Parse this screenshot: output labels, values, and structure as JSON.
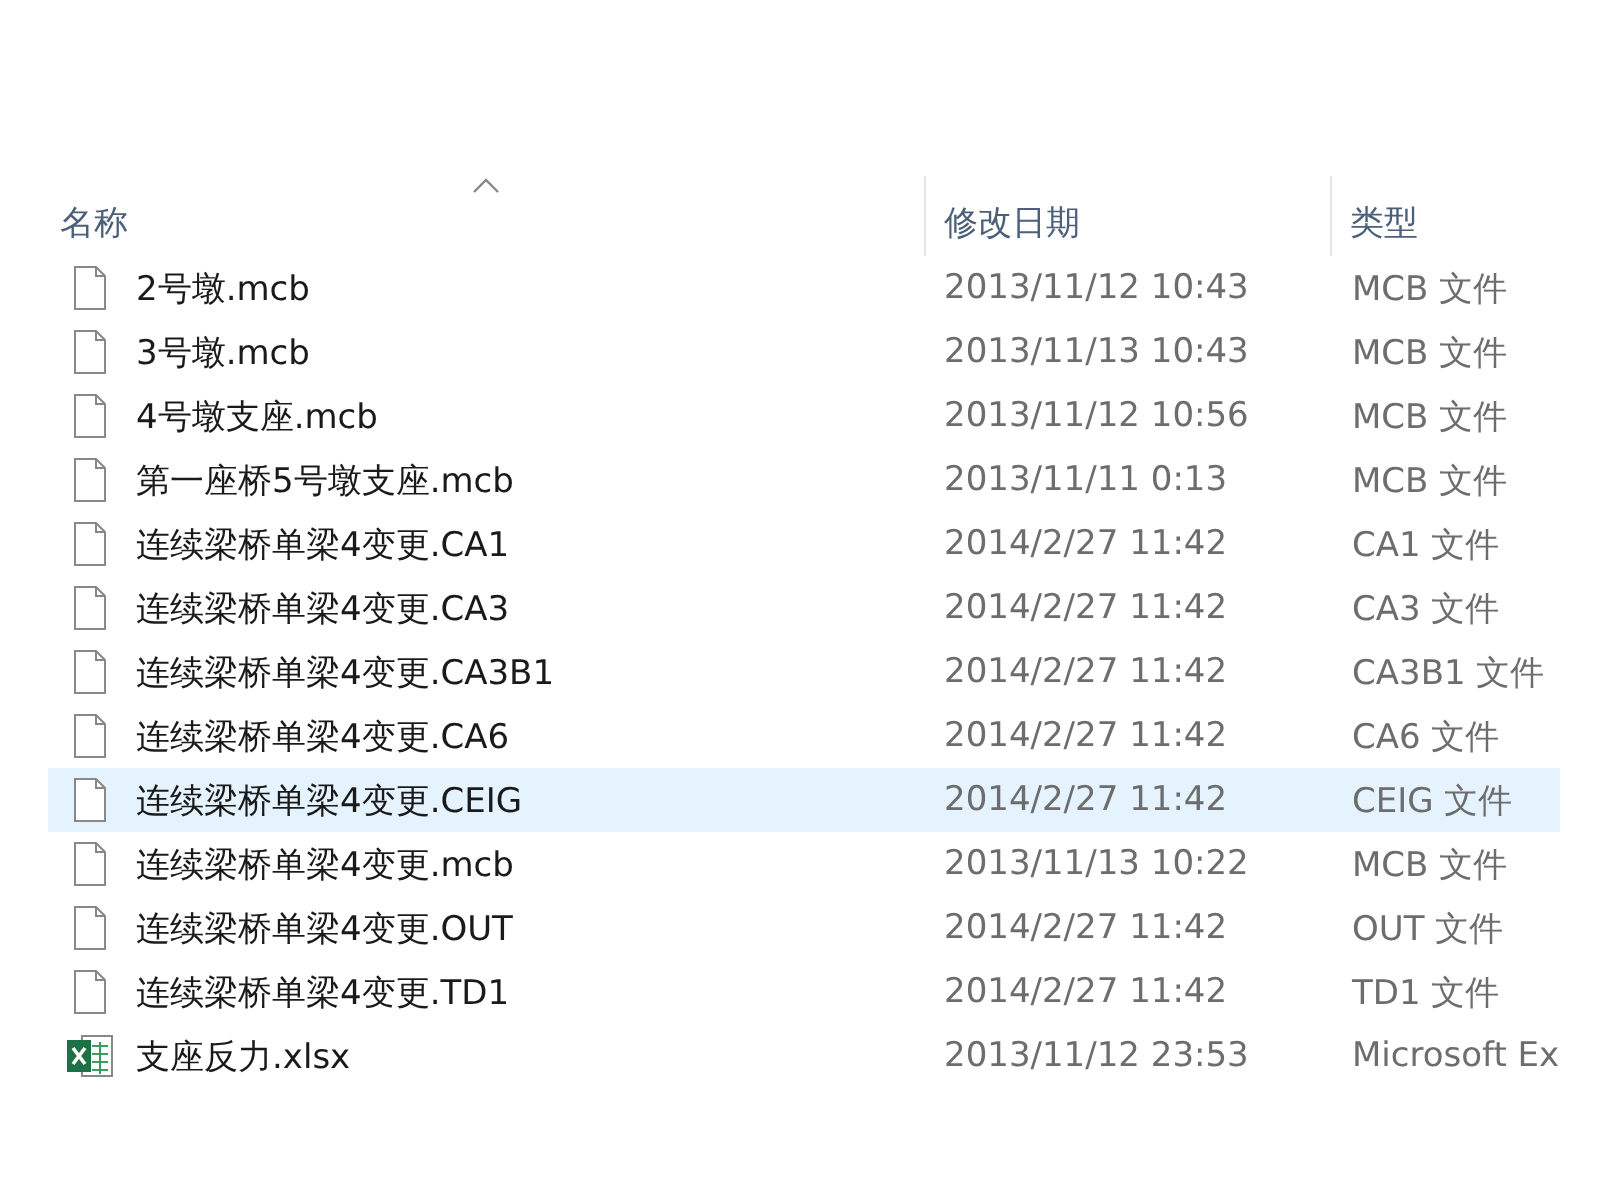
{
  "columns": [
    {
      "label": "名称",
      "sorted": true
    },
    {
      "label": "修改日期",
      "sorted": false
    },
    {
      "label": "类型",
      "sorted": false
    }
  ],
  "rows": [
    {
      "name": "2号墩.mcb",
      "date": "2013/11/12 10:43",
      "type": "MCB 文件",
      "kind": "file",
      "selected": false
    },
    {
      "name": "3号墩.mcb",
      "date": "2013/11/13 10:43",
      "type": "MCB 文件",
      "kind": "file",
      "selected": false
    },
    {
      "name": "4号墩支座.mcb",
      "date": "2013/11/12 10:56",
      "type": "MCB 文件",
      "kind": "file",
      "selected": false
    },
    {
      "name": "第一座桥5号墩支座.mcb",
      "date": "2013/11/11 0:13",
      "type": "MCB 文件",
      "kind": "file",
      "selected": false
    },
    {
      "name": "连续梁桥单梁4变更.CA1",
      "date": "2014/2/27 11:42",
      "type": "CA1 文件",
      "kind": "file",
      "selected": false
    },
    {
      "name": "连续梁桥单梁4变更.CA3",
      "date": "2014/2/27 11:42",
      "type": "CA3 文件",
      "kind": "file",
      "selected": false
    },
    {
      "name": "连续梁桥单梁4变更.CA3B1",
      "date": "2014/2/27 11:42",
      "type": "CA3B1 文件",
      "kind": "file",
      "selected": false
    },
    {
      "name": "连续梁桥单梁4变更.CA6",
      "date": "2014/2/27 11:42",
      "type": "CA6 文件",
      "kind": "file",
      "selected": false
    },
    {
      "name": "连续梁桥单梁4变更.CEIG",
      "date": "2014/2/27 11:42",
      "type": "CEIG 文件",
      "kind": "file",
      "selected": true
    },
    {
      "name": "连续梁桥单梁4变更.mcb",
      "date": "2013/11/13 10:22",
      "type": "MCB 文件",
      "kind": "file",
      "selected": false
    },
    {
      "name": "连续梁桥单梁4变更.OUT",
      "date": "2014/2/27 11:42",
      "type": "OUT 文件",
      "kind": "file",
      "selected": false
    },
    {
      "name": "连续梁桥单梁4变更.TD1",
      "date": "2014/2/27 11:42",
      "type": "TD1 文件",
      "kind": "file",
      "selected": false
    },
    {
      "name": "支座反力.xlsx",
      "date": "2013/11/12 23:53",
      "type": "Microsoft Ex",
      "kind": "spreadsheet",
      "selected": false
    }
  ]
}
